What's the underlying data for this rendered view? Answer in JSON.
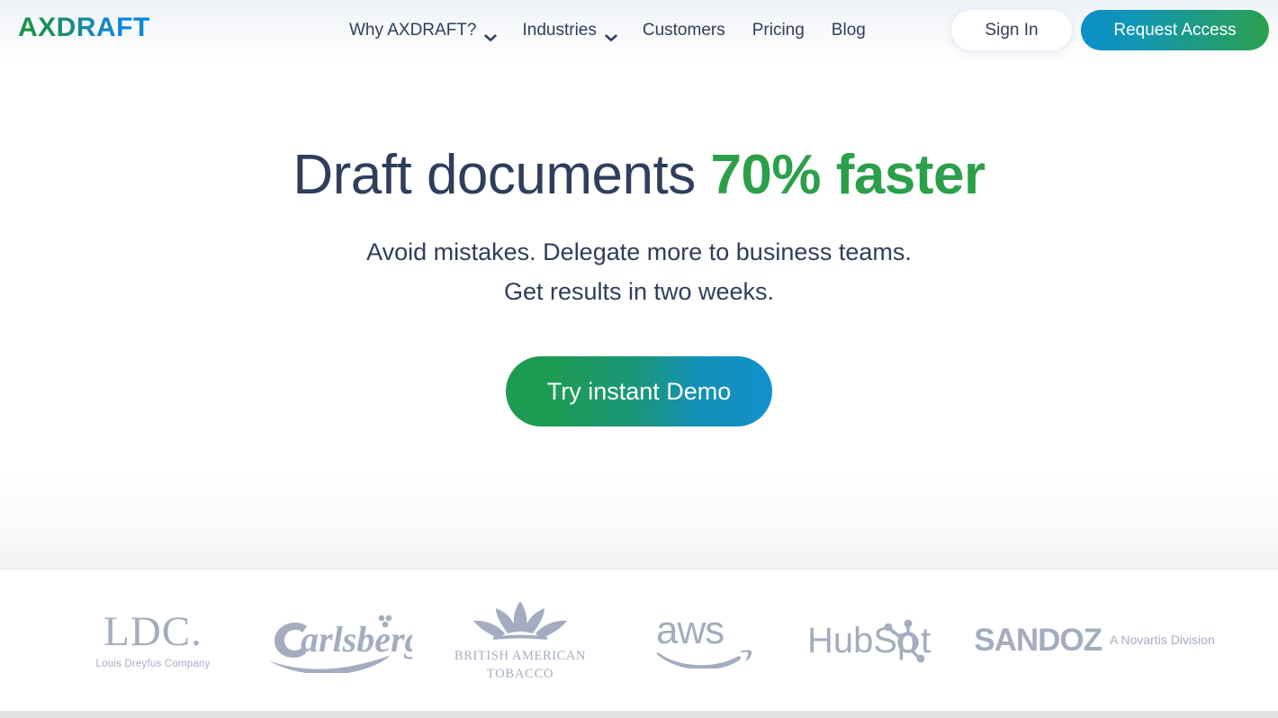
{
  "brand": {
    "logo_text": "AXDRAFT",
    "gradient_start": "#189447",
    "gradient_end": "#0a86e0"
  },
  "nav": {
    "items": [
      {
        "label": "Why AXDRAFT?",
        "has_dropdown": true,
        "icon": "chevron-down-icon"
      },
      {
        "label": "Industries",
        "has_dropdown": true,
        "icon": "chevron-down-icon"
      },
      {
        "label": "Customers",
        "has_dropdown": false,
        "icon": ""
      },
      {
        "label": "Pricing",
        "has_dropdown": false,
        "icon": ""
      },
      {
        "label": "Blog",
        "has_dropdown": false,
        "icon": ""
      }
    ],
    "sign_in_label": "Sign In",
    "request_access_label": "Request Access",
    "text_color": "#2e3e5c",
    "request_gradient_start": "#0a8fc9",
    "request_gradient_end": "#2ba04f"
  },
  "hero": {
    "title_plain": "Draft documents ",
    "title_highlight": "70% faster",
    "highlight_color": "#2c9f4b",
    "subtitle": "Avoid mistakes. Delegate more to business teams. Get results in two weeks.",
    "cta_label": "Try instant Demo",
    "cta_gradient_start": "#1e9b52",
    "cta_gradient_end": "#1190cf"
  },
  "logos": {
    "color": "#a4adbf",
    "items": [
      {
        "name": "ldc",
        "main": "LDC.",
        "sub": "Louis Dreyfus Company"
      },
      {
        "name": "carlsberg",
        "main": "Carlsberg",
        "sub": ""
      },
      {
        "name": "british-american-tobacco",
        "main": "BRITISH AMERICAN",
        "sub": "TOBACCO"
      },
      {
        "name": "aws",
        "main": "aws",
        "sub": ""
      },
      {
        "name": "hubspot",
        "main": "HubSp",
        "sub": "t"
      },
      {
        "name": "sandoz",
        "main": "SANDOZ",
        "sub": "A Novartis Division"
      }
    ]
  }
}
